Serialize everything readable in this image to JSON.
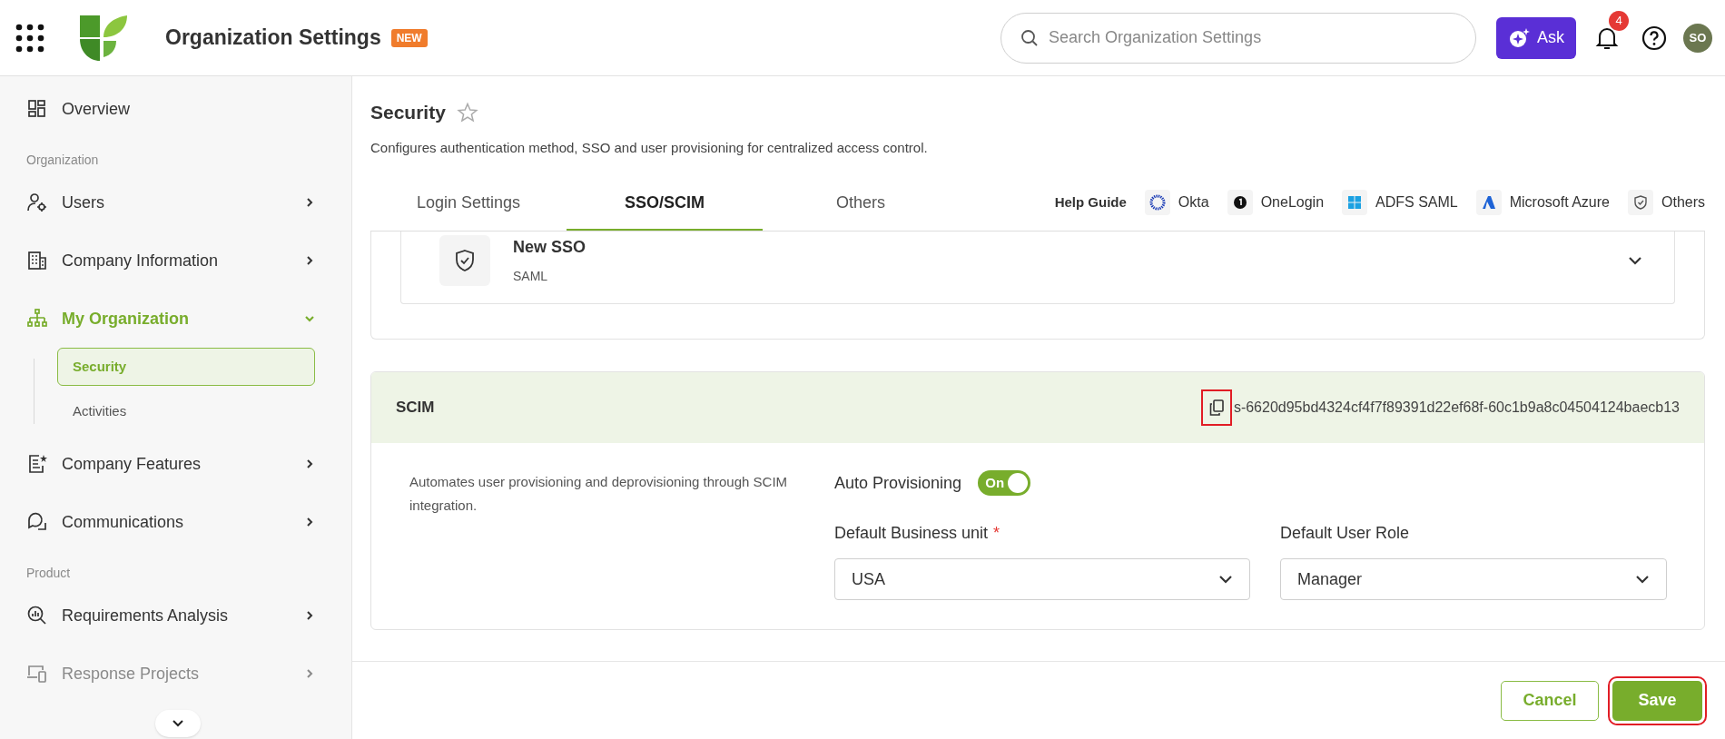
{
  "header": {
    "title": "Organization Settings",
    "badge": "NEW",
    "search": {
      "placeholder": "Search Organization Settings"
    },
    "ask_label": "Ask",
    "notification_count": "4",
    "avatar_initials": "SO"
  },
  "sidebar": {
    "items": [
      {
        "kind": "item",
        "label": "Overview",
        "has_arrow": false
      },
      {
        "kind": "heading",
        "label": "Organization"
      },
      {
        "kind": "item",
        "label": "Users",
        "has_arrow": true
      },
      {
        "kind": "item",
        "label": "Company Information",
        "has_arrow": true
      },
      {
        "kind": "item",
        "label": "My Organization",
        "has_arrow": true,
        "active": true,
        "expanded": true,
        "children": [
          {
            "label": "Security",
            "selected": true
          },
          {
            "label": "Activities",
            "selected": false
          }
        ]
      },
      {
        "kind": "item",
        "label": "Company Features",
        "has_arrow": true
      },
      {
        "kind": "item",
        "label": "Communications",
        "has_arrow": true
      },
      {
        "kind": "heading",
        "label": "Product"
      },
      {
        "kind": "item",
        "label": "Requirements Analysis",
        "has_arrow": true
      },
      {
        "kind": "item",
        "label": "Response Projects",
        "has_arrow": true,
        "faded": true
      }
    ]
  },
  "page": {
    "title": "Security",
    "favorite": false,
    "description": "Configures authentication method, SSO and user provisioning for centralized access control.",
    "tabs": [
      {
        "label": "Login Settings",
        "selected": false
      },
      {
        "label": "SSO/SCIM",
        "selected": true
      },
      {
        "label": "Others",
        "selected": false
      }
    ],
    "help_guide": {
      "label": "Help Guide",
      "links": [
        "Okta",
        "OneLogin",
        "ADFS SAML",
        "Microsoft Azure",
        "Others"
      ]
    },
    "sso": {
      "name": "New SSO",
      "type": "SAML",
      "expanded": false
    },
    "scim": {
      "title": "SCIM",
      "token": "s-6620d95bd4324cf4f7f89391d22ef68f-60c1b9a8c04504124baecb13",
      "copy_highlighted": true,
      "description": "Automates user provisioning and deprovisioning through SCIM integration.",
      "auto_provisioning": {
        "label": "Auto Provisioning",
        "on": true,
        "state_label": "On"
      },
      "fields": [
        {
          "label": "Default Business unit",
          "required_mark": "*",
          "value": "USA"
        },
        {
          "label": "Default User Role",
          "value": "Manager"
        }
      ]
    }
  },
  "footer": {
    "buttons": [
      {
        "label": "Cancel",
        "kind": "secondary",
        "highlighted": false
      },
      {
        "label": "Save",
        "kind": "primary",
        "highlighted": true
      }
    ]
  }
}
